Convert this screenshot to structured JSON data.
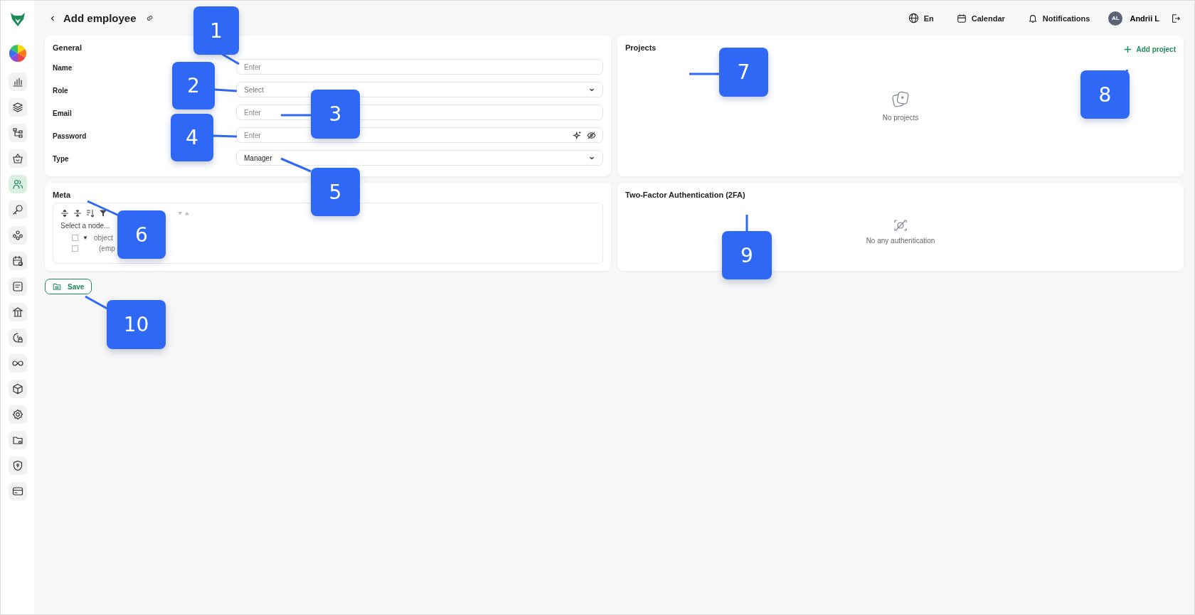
{
  "sidebar": {
    "items": [
      {
        "selected": false
      },
      {
        "selected": false
      },
      {
        "selected": false
      },
      {
        "selected": false
      },
      {
        "selected": true
      },
      {
        "selected": false
      },
      {
        "selected": false
      },
      {
        "selected": false
      },
      {
        "selected": false
      },
      {
        "selected": false
      },
      {
        "selected": false
      },
      {
        "selected": false
      },
      {
        "selected": false
      },
      {
        "selected": false
      },
      {
        "selected": false
      },
      {
        "selected": false
      },
      {
        "selected": false
      }
    ]
  },
  "header": {
    "title": "Add employee",
    "language": "En",
    "calendar": "Calendar",
    "notifications": "Notifications",
    "avatar_initials": "AL",
    "user_name": "Andrii L"
  },
  "general": {
    "title": "General",
    "fields": [
      {
        "label": "Name",
        "kind": "input",
        "placeholder": "Enter"
      },
      {
        "label": "Role",
        "kind": "select",
        "placeholder": "Select"
      },
      {
        "label": "Email",
        "kind": "input",
        "placeholder": "Enter"
      },
      {
        "label": "Password",
        "kind": "password",
        "placeholder": "Enter"
      },
      {
        "label": "Type",
        "kind": "select",
        "value": "Manager"
      }
    ]
  },
  "meta": {
    "title": "Meta",
    "hint": "Select a node...",
    "tree": [
      {
        "label": "object",
        "toggle": "▼",
        "expanded": true,
        "checked": false,
        "children": [
          {
            "label": "(emp",
            "checked": false
          }
        ]
      }
    ]
  },
  "projects": {
    "title": "Projects",
    "add_label": "Add project",
    "empty_text": "No projects"
  },
  "two_factor": {
    "title": "Two-Factor Authentication (2FA)",
    "empty_text": "No any authentication"
  },
  "save_label": "Save",
  "callouts": [
    "1",
    "2",
    "3",
    "4",
    "5",
    "6",
    "7",
    "8",
    "9",
    "10"
  ]
}
